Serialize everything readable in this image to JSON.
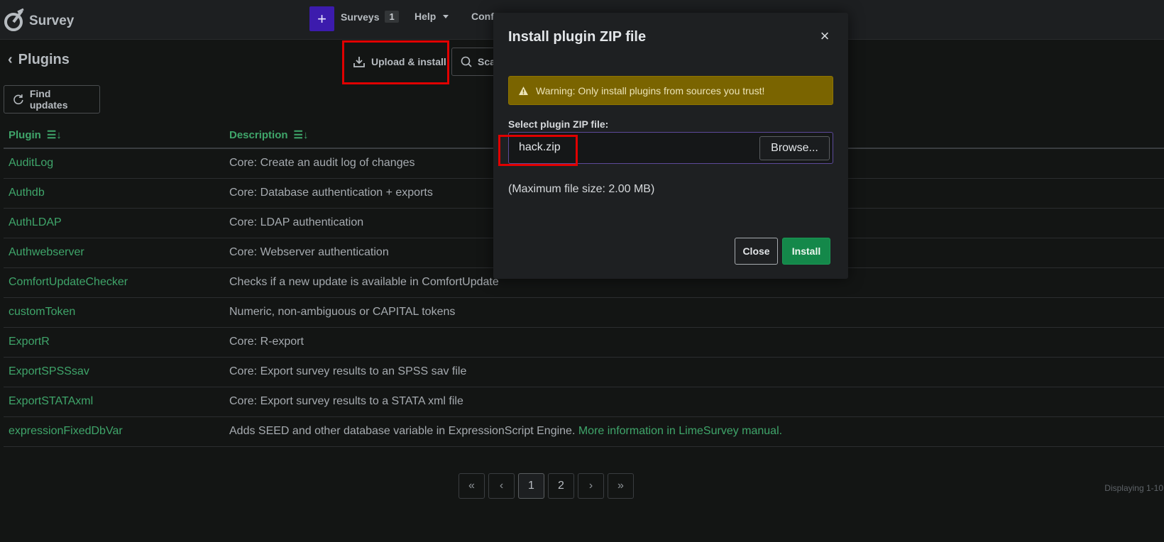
{
  "navbar": {
    "brand": "Survey",
    "plus_label": "+",
    "surveys_label": "Surveys",
    "surveys_count": "1",
    "help_label": "Help",
    "config_label": "Confi"
  },
  "page": {
    "title": "Plugins",
    "upload_install_label": "Upload & install",
    "scan_label": "Sca",
    "find_updates_label": "Find updates"
  },
  "table": {
    "headers": [
      "Plugin",
      "Description"
    ],
    "rows": [
      {
        "name": "AuditLog",
        "desc": "Core: Create an audit log of changes",
        "link": ""
      },
      {
        "name": "Authdb",
        "desc": "Core: Database authentication + exports",
        "link": ""
      },
      {
        "name": "AuthLDAP",
        "desc": "Core: LDAP authentication",
        "link": ""
      },
      {
        "name": "Authwebserver",
        "desc": "Core: Webserver authentication",
        "link": ""
      },
      {
        "name": "ComfortUpdateChecker",
        "desc": "Checks if a new update is available in ComfortUpdate",
        "link": ""
      },
      {
        "name": "customToken",
        "desc": "Numeric, non-ambiguous or CAPITAL tokens",
        "link": ""
      },
      {
        "name": "ExportR",
        "desc": "Core: R-export",
        "link": ""
      },
      {
        "name": "ExportSPSSsav",
        "desc": "Core: Export survey results to an SPSS sav file",
        "link": ""
      },
      {
        "name": "ExportSTATAxml",
        "desc": "Core: Export survey results to a STATA xml file",
        "link": ""
      },
      {
        "name": "expressionFixedDbVar",
        "desc": "Adds SEED and other database variable in ExpressionScript Engine. ",
        "link": "More information in LimeSurvey manual."
      }
    ]
  },
  "pager": {
    "first": "«",
    "prev": "‹",
    "pages": [
      "1",
      "2"
    ],
    "active_page": "1",
    "next": "›",
    "last": "»",
    "displaying": "Displaying 1-10"
  },
  "modal": {
    "title": "Install plugin ZIP file",
    "close_icon": "×",
    "warning": "Warning: Only install plugins from sources you trust!",
    "file_label": "Select plugin ZIP file:",
    "file_value": "hack.zip",
    "browse_label": "Browse...",
    "max_size": "(Maximum file size: 2.00 MB)",
    "close_label": "Close",
    "install_label": "Install"
  },
  "colors": {
    "accent_purple": "#3c1bad",
    "link_green": "#3fa56a",
    "install_green": "#14884a",
    "warning_bg": "#7a6400",
    "highlight_red": "#e00000"
  }
}
